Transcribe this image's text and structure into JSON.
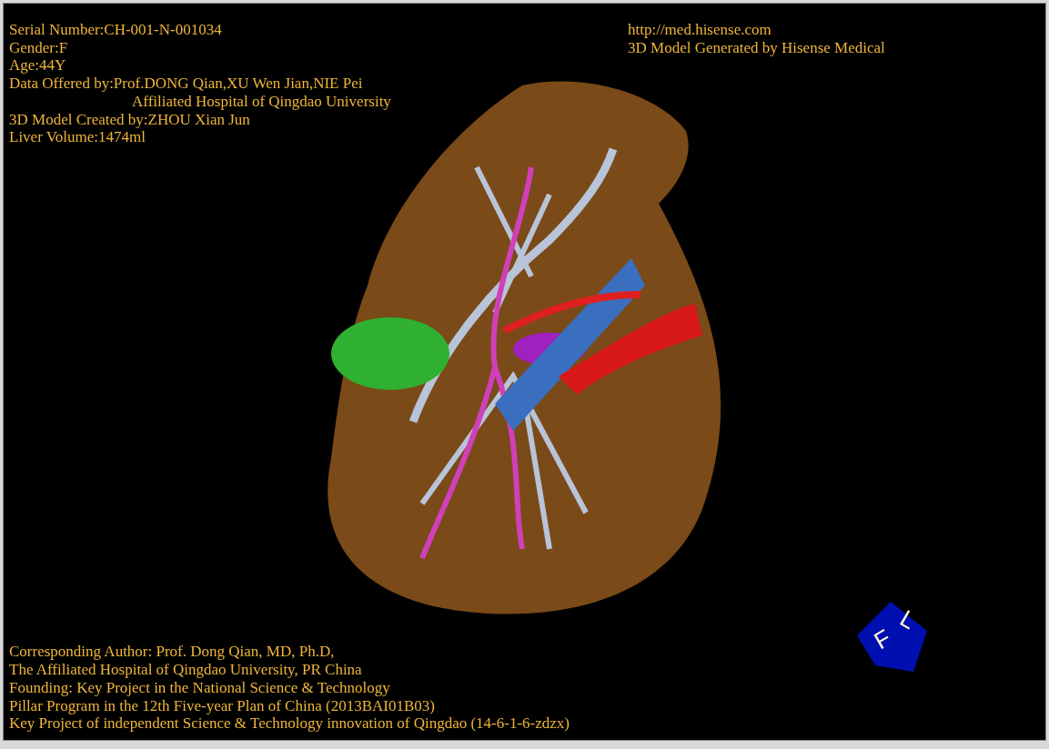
{
  "viewport": {
    "info_lines": [
      {
        "text": "Serial Number:CH-001-N-001034",
        "kind": "line"
      },
      {
        "text": "Gender:F",
        "kind": "line"
      },
      {
        "text": "Age:44Y",
        "kind": "line"
      },
      {
        "text": "Data Offered by:Prof.DONG Qian,XU Wen Jian,NIE Pei",
        "kind": "line"
      },
      {
        "text": "Affiliated Hospital of Qingdao University",
        "kind": "indent"
      },
      {
        "text": "3D Model Created by:ZHOU Xian Jun",
        "kind": "line"
      },
      {
        "text": "Liver Volume:1474ml",
        "kind": "line"
      }
    ],
    "header_right": [
      "http://med.hisense.com",
      "3D Model Generated by Hisense Medical"
    ],
    "footer_lines": [
      "Corresponding Author: Prof. Dong Qian, MD, Ph.D,",
      "The Affiliated Hospital of Qingdao University, PR China",
      "Founding: Key Project in the National Science & Technology",
      "Pillar Program in the 12th Five-year Plan of China (2013BAI01B03)",
      "Key Project of independent Science & Technology innovation of Qingdao (14-6-1-6-zdzx)"
    ],
    "orientation_cube": {
      "labels": [
        "F",
        "L"
      ]
    }
  }
}
